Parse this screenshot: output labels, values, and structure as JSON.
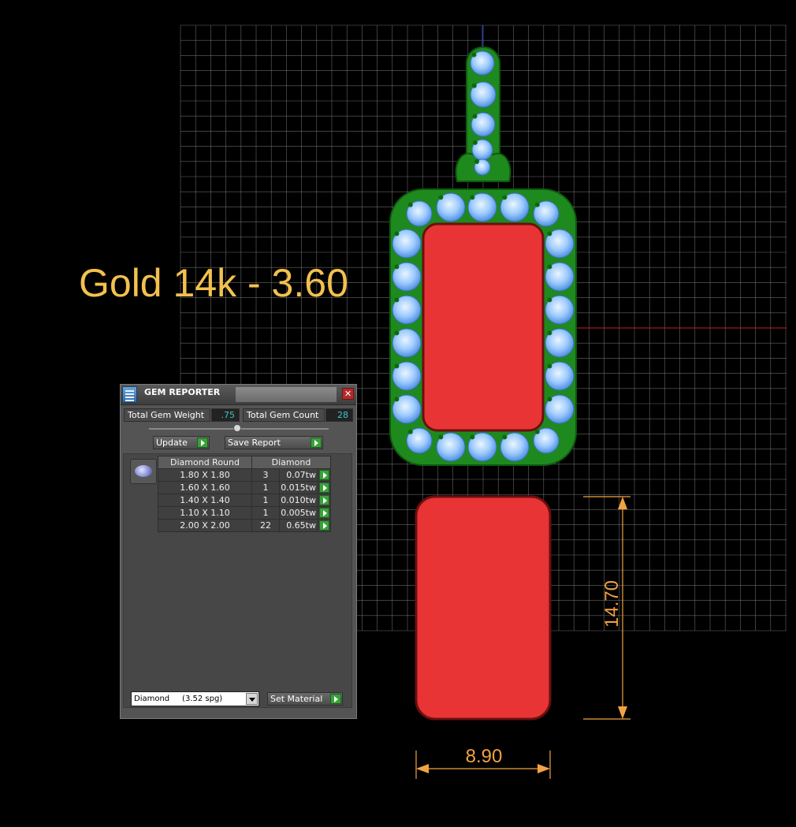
{
  "viewport": {
    "material_caption": "Gold 14k - 3.60",
    "dimension_width": "8.90",
    "dimension_height": "14.70",
    "colors": {
      "background": "#000000",
      "grid": "#808080",
      "metal": "#1e8a1e",
      "gem": "#9ecbff",
      "center_stone": "#e83434",
      "caption": "#f2c14e",
      "dimension": "#f2a341",
      "axis_x": "#c81e1e",
      "axis_y": "#2a3fd6"
    }
  },
  "gem_reporter": {
    "title": "GEM REPORTER",
    "close_glyph": "✕",
    "total_gem_weight_label": "Total Gem Weight",
    "total_gem_weight_value": ".75",
    "total_gem_count_label": "Total Gem Count",
    "total_gem_count_value": "28",
    "update_label": "Update",
    "save_report_label": "Save Report",
    "table": {
      "col_shape": "Diamond Round",
      "col_material": "Diamond",
      "rows": [
        {
          "size": "1.80 X 1.80",
          "count": "3",
          "weight": "0.07tw"
        },
        {
          "size": "1.60 X 1.60",
          "count": "1",
          "weight": "0.015tw"
        },
        {
          "size": "1.40 X 1.40",
          "count": "1",
          "weight": "0.010tw"
        },
        {
          "size": "1.10 X 1.10",
          "count": "1",
          "weight": "0.005tw"
        },
        {
          "size": "2.00 X 2.00",
          "count": "22",
          "weight": "0.65tw"
        }
      ]
    },
    "material_select": "Diamond     (3.52 spg)",
    "set_material_label": "Set Material",
    "icons": {
      "app": "gem-reporter-app-icon",
      "close": "close-icon",
      "play": "play-arrow-icon",
      "gem_thumb": "round-gem-icon",
      "dropdown": "chevron-down-icon"
    }
  }
}
